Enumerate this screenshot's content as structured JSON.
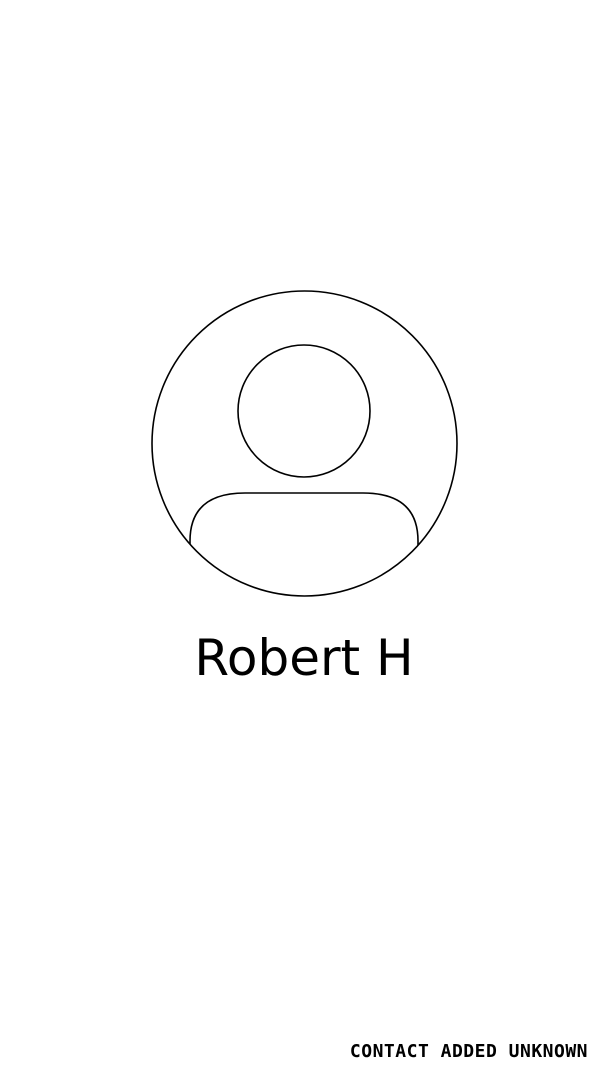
{
  "contact": {
    "name": "Robert H",
    "avatar_icon": "default-person-icon"
  },
  "status": {
    "text": "CONTACT ADDED UNKNOWN"
  },
  "colors": {
    "background": "#ffffff",
    "foreground": "#000000"
  }
}
